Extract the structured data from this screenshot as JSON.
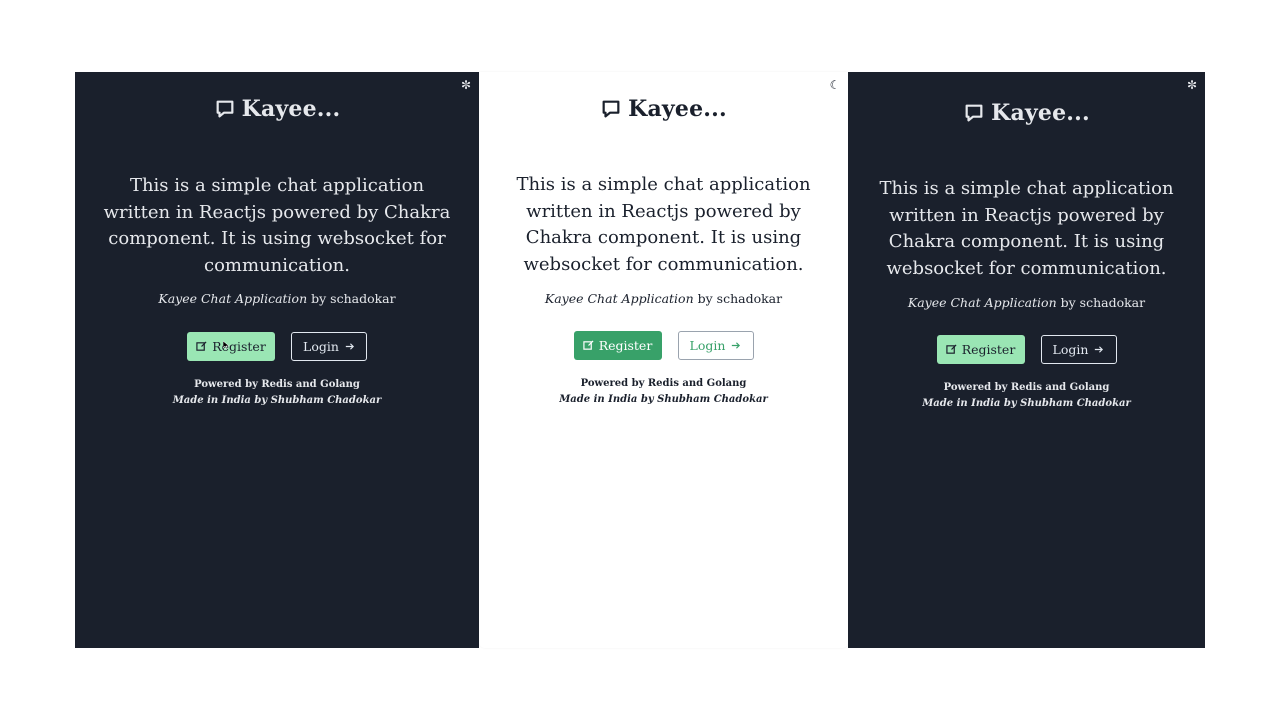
{
  "panels": [
    {
      "theme": "dark",
      "toggle_icon": "sun-icon",
      "brand": "Kayee...",
      "description": "This is a simple chat application written in Reactjs powered by Chakra component. It is using websocket for communication.",
      "byline_title": "Kayee Chat Application",
      "byline_rest": " by schadokar",
      "register_label": "Register",
      "login_label": "Login",
      "powered_by": "Powered by Redis and Golang",
      "made_in": "Made in India by Shubham Chadokar"
    },
    {
      "theme": "light",
      "toggle_icon": "moon-icon",
      "brand": "Kayee...",
      "description": "This is a simple chat application written in Reactjs powered by Chakra component. It is using websocket for communication.",
      "byline_title": "Kayee Chat Application",
      "byline_rest": " by schadokar",
      "register_label": "Register",
      "login_label": "Login",
      "powered_by": "Powered by Redis and Golang",
      "made_in": "Made in India by Shubham Chadokar"
    },
    {
      "theme": "dark",
      "toggle_icon": "sun-icon",
      "brand": "Kayee...",
      "description": "This is a simple chat application written in Reactjs powered by Chakra component. It is using websocket for communication.",
      "byline_title": "Kayee Chat Application",
      "byline_rest": " by schadokar",
      "register_label": "Register",
      "login_label": "Login",
      "powered_by": "Powered by Redis and Golang",
      "made_in": "Made in India by Shubham Chadokar"
    }
  ],
  "colors": {
    "dark_bg": "#1a202c",
    "light_bg": "#ffffff",
    "dark_register": "#9ae6b4",
    "light_register": "#38a169"
  }
}
